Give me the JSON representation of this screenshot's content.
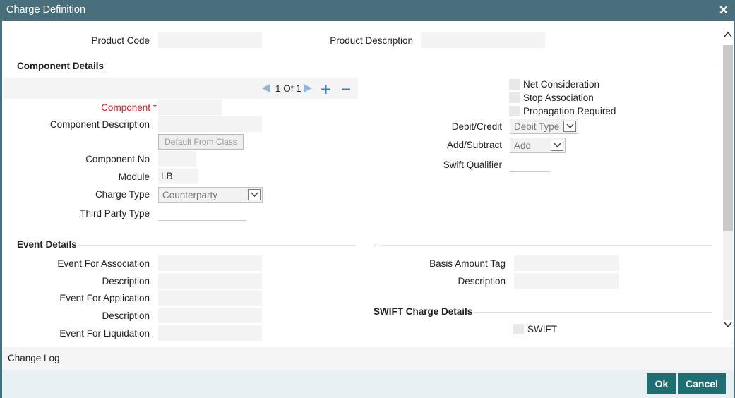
{
  "window": {
    "title": "Charge Definition",
    "close_symbol": "✕"
  },
  "product": {
    "code_label": "Product Code",
    "code_value": "",
    "description_label": "Product Description",
    "description_value": ""
  },
  "component_details": {
    "header": "Component Details",
    "pager_text": "1 Of 1",
    "component_label": "Component",
    "required_mark": " *",
    "component_value": "",
    "component_description_label": "Component Description",
    "component_description_value": "",
    "default_from_class_label": "Default From Class",
    "component_no_label": "Component No",
    "component_no_value": "",
    "module_label": "Module",
    "module_value": "LB",
    "charge_type_label": "Charge Type",
    "charge_type_value": "Counterparty",
    "third_party_type_label": "Third Party Type",
    "third_party_type_value": "",
    "net_consideration_label": "Net Consideration",
    "stop_association_label": "Stop Association",
    "propagation_required_label": "Propagation Required",
    "debit_credit_label": "Debit/Credit",
    "debit_credit_value": "Debit Type",
    "add_subtract_label": "Add/Subtract",
    "add_subtract_value": "Add",
    "swift_qualifier_label": "Swift Qualifier",
    "swift_qualifier_value": ""
  },
  "event_details": {
    "header": "Event Details",
    "right_marker": "-",
    "event_for_association_label": "Event For Association",
    "description1_label": "Description",
    "event_for_application_label": "Event For Application",
    "description2_label": "Description",
    "event_for_liquidation_label": "Event For Liquidation",
    "basis_amount_tag_label": "Basis Amount Tag",
    "description3_label": "Description"
  },
  "swift_charge_details": {
    "header": "SWIFT Charge Details",
    "swift_label": "SWIFT"
  },
  "footer": {
    "change_log_label": "Change Log",
    "ok_label": "Ok",
    "cancel_label": "Cancel"
  },
  "colors": {
    "title_bar": "#4a6f7c",
    "primary_button": "#1e6f74",
    "required": "#cc2222",
    "pager_icon": "#4a90d9"
  },
  "icons": {
    "pager_prev": "triangle-left-icon",
    "pager_next": "triangle-right-icon",
    "add": "plus-icon",
    "remove": "minus-icon",
    "scroll_up": "chevron-up-icon",
    "scroll_down": "chevron-down-icon"
  }
}
